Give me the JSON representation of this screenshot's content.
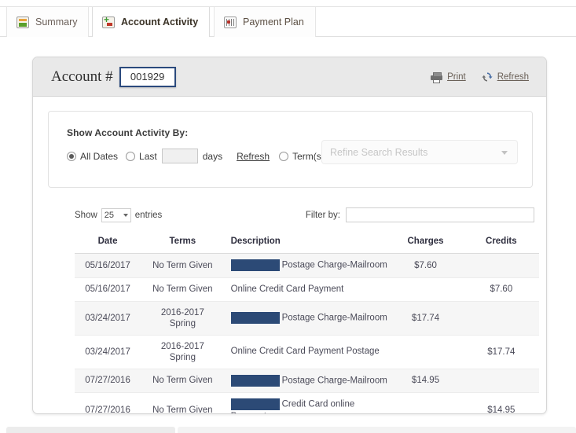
{
  "tabs": [
    {
      "label": "Summary",
      "icon": "summary-icon",
      "active": false
    },
    {
      "label": "Account Activity",
      "icon": "account-activity-icon",
      "active": true
    },
    {
      "label": "Payment Plan",
      "icon": "payment-plan-icon",
      "active": false
    }
  ],
  "panel": {
    "account_label": "Account #",
    "account_number": "001929",
    "actions": [
      {
        "label": "Print",
        "icon": "printer-icon"
      },
      {
        "label": "Refresh",
        "icon": "refresh-icon"
      }
    ]
  },
  "search": {
    "title": "Show Account Activity By:",
    "all_dates_label": "All Dates",
    "all_dates_selected": true,
    "last_label": "Last",
    "last_selected": false,
    "days_value": "",
    "days_label": "days",
    "refresh_link": "Refresh",
    "terms_label": "Term(s)",
    "terms_selected": false,
    "refine_placeholder": "Refine Search Results",
    "refine_value": ""
  },
  "table_controls": {
    "show_label": "Show",
    "entries_value": "25",
    "entries_label": "entries",
    "filter_label": "Filter by:",
    "filter_value": ""
  },
  "table": {
    "columns": [
      "Date",
      "Terms",
      "Description",
      "Charges",
      "Credits"
    ],
    "rows": [
      {
        "date": "05/16/2017",
        "terms": "No Term Given",
        "redacted": true,
        "description": "Postage Charge-Mailroom",
        "charges": "$7.60",
        "credits": ""
      },
      {
        "date": "05/16/2017",
        "terms": "No Term Given",
        "redacted": false,
        "description": "Online Credit Card Payment",
        "charges": "",
        "credits": "$7.60"
      },
      {
        "date": "03/24/2017",
        "terms": "2016-2017 Spring",
        "redacted": true,
        "description": "Postage Charge-Mailroom",
        "charges": "$17.74",
        "credits": ""
      },
      {
        "date": "03/24/2017",
        "terms": "2016-2017 Spring",
        "redacted": false,
        "description": "Online Credit Card Payment Postage",
        "charges": "",
        "credits": "$17.74"
      },
      {
        "date": "07/27/2016",
        "terms": "No Term Given",
        "redacted": true,
        "description": "Postage Charge-Mailroom",
        "charges": "$14.95",
        "credits": ""
      },
      {
        "date": "07/27/2016",
        "terms": "No Term Given",
        "redacted": true,
        "description": "Credit Card online Payment",
        "charges": "",
        "credits": "$14.95"
      }
    ]
  },
  "colors": {
    "redaction": "#2c4a76",
    "account_box_border": "#2b4a7d",
    "panel_header_bg": "#e9e9e9",
    "row_stripe": "#f6f6f6"
  }
}
